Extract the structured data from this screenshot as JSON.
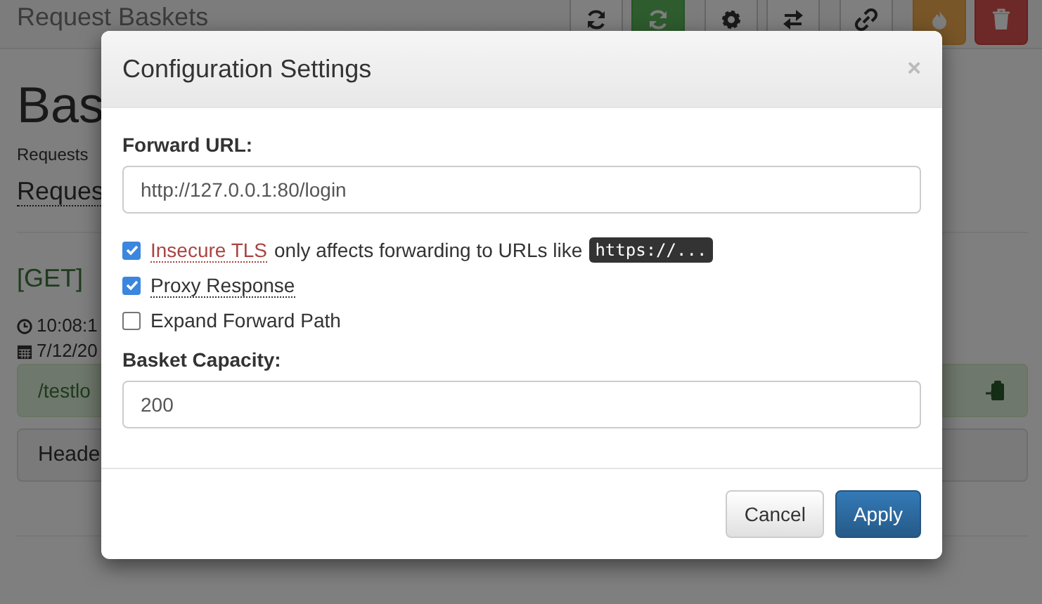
{
  "navbar": {
    "brand": "Request Baskets",
    "buttons": [
      {
        "kind": "refresh"
      },
      {
        "kind": "reload"
      },
      {
        "kind": "gear"
      },
      {
        "kind": "exchange"
      },
      {
        "kind": "link"
      },
      {
        "kind": "fire"
      },
      {
        "kind": "trash"
      }
    ]
  },
  "page": {
    "title": "Bas",
    "subtitle": "Requests",
    "requests_link": "Reques",
    "request": {
      "method": "[GET]",
      "time": "10:08:1",
      "date": "7/12/20",
      "path": "/testlo",
      "headers_tab": "Heade"
    }
  },
  "modal": {
    "title": "Configuration Settings",
    "close": "×",
    "forward_url": {
      "label": "Forward URL:",
      "value": "http://127.0.0.1:80/login"
    },
    "options": [
      {
        "kind": "warning",
        "label": "Insecure TLS",
        "note": "only affects forwarding to URLs like",
        "code": "https://...",
        "checked": true
      },
      {
        "kind": "hint",
        "label": "Proxy Response",
        "checked": true
      },
      {
        "kind": "plain",
        "label": "Expand Forward Path",
        "checked": false
      }
    ],
    "capacity": {
      "label": "Basket Capacity:",
      "value": "200"
    },
    "buttons": [
      {
        "label": "Cancel",
        "primary": false
      },
      {
        "label": "Apply",
        "primary": true
      }
    ]
  }
}
